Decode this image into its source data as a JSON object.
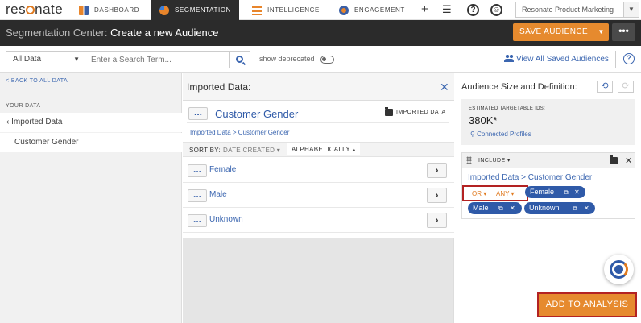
{
  "app": {
    "logo_text": "resonate"
  },
  "nav": {
    "tabs": [
      {
        "label": "DASHBOARD"
      },
      {
        "label": "SEGMENTATION"
      },
      {
        "label": "INTELLIGENCE"
      },
      {
        "label": "ENGAGEMENT"
      }
    ],
    "icons": [
      "plus-icon",
      "list-icon",
      "help-icon",
      "profile-icon"
    ],
    "account": "Resonate Product Marketing"
  },
  "titlebar": {
    "prefix": "Segmentation Center:",
    "title": "Create a new Audience",
    "save_label": "SAVE AUDIENCE",
    "more_label": "•••"
  },
  "filter": {
    "scope_value": "All Data",
    "search_placeholder": "Enter a Search Term...",
    "deprecated_label": "show deprecated",
    "view_all_label": "View All Saved Audiences"
  },
  "left": {
    "back_label": "< BACK TO ALL DATA",
    "section_label": "YOUR DATA",
    "folder_label": "Imported Data",
    "item_label": "Customer Gender"
  },
  "middle": {
    "header": "Imported Data:",
    "card_title": "Customer Gender",
    "imported_badge": "IMPORTED DATA",
    "breadcrumb": "Imported Data > Customer Gender",
    "sort_label": "SORT BY:",
    "sort_date": "DATE CREATED ▾",
    "sort_alpha": "ALPHABETICALLY ▴",
    "rows": [
      {
        "label": "Female"
      },
      {
        "label": "Male"
      },
      {
        "label": "Unknown"
      }
    ]
  },
  "right": {
    "title": "Audience Size and Definition:",
    "estimate_label": "ESTIMATED TARGETABLE IDS:",
    "estimate_value": "380K*",
    "connected_label": "Connected Profiles",
    "include_label": "INCLUDE ▾",
    "path": "Imported Data > Customer Gender",
    "or_label": "OR ▾",
    "any_label": "ANY ▾",
    "pills": [
      {
        "label": "Female"
      },
      {
        "label": "Male"
      },
      {
        "label": "Unknown"
      }
    ],
    "add_label": "ADD TO ANALYSIS"
  },
  "colors": {
    "accent": "#e68a2e",
    "link": "#2f5aa8",
    "dark": "#2b2b2b",
    "highlight": "#b32222"
  }
}
